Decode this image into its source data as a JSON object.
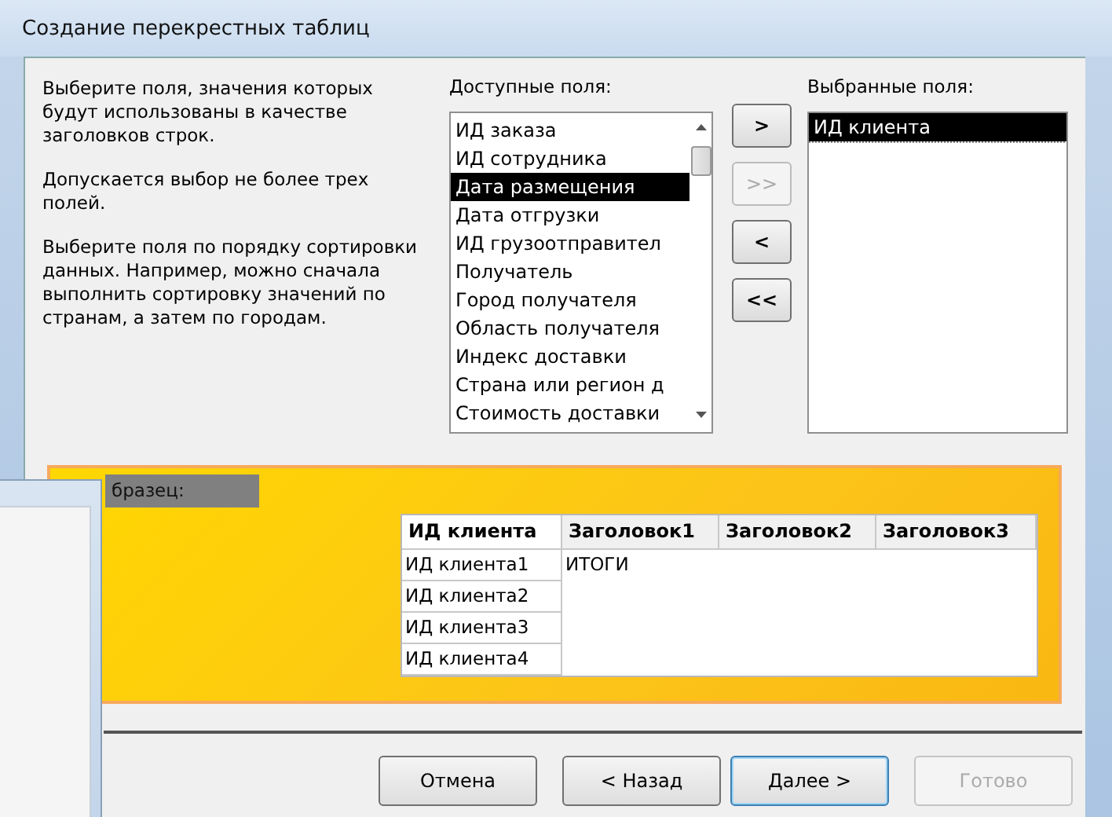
{
  "window": {
    "title": "Создание перекрестных таблиц"
  },
  "instructions": [
    "Выберите поля, значения которых будут использованы в качестве заголовков строк.",
    "Допускается выбор не более трех полей.",
    "Выберите поля по порядку сортировки данных.  Например, можно сначала выполнить сортировку значений по странам, а затем по городам."
  ],
  "available_fields": {
    "label": "Доступные поля:",
    "items": [
      {
        "text": "ИД заказа",
        "selected": false
      },
      {
        "text": "ИД сотрудника",
        "selected": false
      },
      {
        "text": "Дата размещения",
        "selected": true
      },
      {
        "text": "Дата отгрузки",
        "selected": false
      },
      {
        "text": "ИД грузоотправител",
        "selected": false
      },
      {
        "text": "Получатель",
        "selected": false
      },
      {
        "text": "Город получателя",
        "selected": false
      },
      {
        "text": "Область получателя",
        "selected": false
      },
      {
        "text": "Индекс доставки",
        "selected": false
      },
      {
        "text": "Страна или регион д",
        "selected": false
      },
      {
        "text": "Стоимость доставки",
        "selected": false
      }
    ]
  },
  "move_buttons": [
    {
      "label": ">",
      "disabled": false
    },
    {
      "label": ">>",
      "disabled": true
    },
    {
      "label": "<",
      "disabled": false
    },
    {
      "label": "<<",
      "disabled": false
    }
  ],
  "selected_fields": {
    "label": "Выбранные поля:",
    "items": [
      {
        "text": "ИД клиента",
        "selected": true
      }
    ]
  },
  "sample": {
    "label": "бразец:",
    "columns": [
      "ИД клиента",
      "Заголовок1",
      "Заголовок2",
      "Заголовок3"
    ],
    "rows": [
      {
        "header": "ИД клиента1",
        "value": "ИТОГИ"
      },
      {
        "header": "ИД клиента2"
      },
      {
        "header": "ИД клиента3"
      },
      {
        "header": "ИД клиента4"
      }
    ]
  },
  "buttons": [
    {
      "label": "Отмена",
      "disabled": false,
      "default": false
    },
    {
      "label": "< Назад",
      "disabled": false,
      "default": false
    },
    {
      "label": "Далее >",
      "disabled": false,
      "default": true
    },
    {
      "label": "Готово",
      "disabled": true,
      "default": false
    }
  ]
}
